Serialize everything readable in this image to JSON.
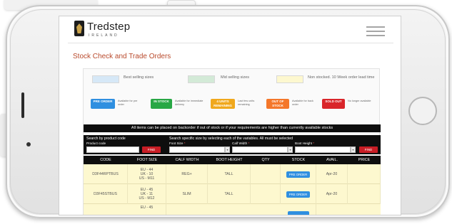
{
  "brand": {
    "name": "Tredstep",
    "sub": "IRELAND"
  },
  "page": {
    "title": "Stock Check and Trade Orders"
  },
  "legend": [
    {
      "label": "Best selling sizes",
      "color": "#d6e8f7"
    },
    {
      "label": "Mid selling sizes",
      "color": "#d3ead7"
    },
    {
      "label": "Non stocked. 10 Week order lead time",
      "color": "#fdf8cf"
    }
  ],
  "statuses": [
    {
      "badge": "PRE ORDER",
      "desc": "Available for pre order",
      "color": "#2f8fe0"
    },
    {
      "badge": "IN STOCK",
      "desc": "Available for immediate delivery",
      "color": "#28a745"
    },
    {
      "badge": "4 UNITS REMAINING",
      "desc": "Last few units remaining",
      "color": "#f0a81c"
    },
    {
      "badge": "OUT OF STOCK",
      "desc": "Available for back order",
      "color": "#f4772a"
    },
    {
      "badge": "SOLD OUT",
      "desc": "No longer available",
      "color": "#d9252a"
    }
  ],
  "backorder_notice": "All items can be placed on backorder if out of stock or if your requirements are higher than currently available stocks",
  "search": {
    "by_product_title": "Search by product code",
    "product_code_label": "Product code",
    "find_label": "FIND",
    "by_size_title": "Search specific size by selecting each of the variables. All must be selected",
    "foot_size_label": "Foot Size",
    "calf_width_label": "Calf Width",
    "boot_height_label": "Boot Height",
    "required_mark": "*",
    "caret": "▾"
  },
  "table": {
    "headers": [
      "CODE",
      "FOOT SIZE",
      "CALF WIDTH",
      "BOOT HEIGHT",
      "QTY",
      "STOCK",
      "AVAIL.",
      "PRICE"
    ],
    "rows": [
      {
        "code": "D3F44RPTBUS",
        "foot": [
          "EU - 44",
          "UK - 10",
          "US - M11"
        ],
        "calf": "REG+",
        "height": "TALL",
        "qty": "",
        "stock": "PRE ORDER",
        "avail": "Apr-20",
        "price": ""
      },
      {
        "code": "D3F45STBUS",
        "foot": [
          "EU - 45",
          "UK - 11",
          "US - M12"
        ],
        "calf": "SLIM",
        "height": "TALL",
        "qty": "",
        "stock": "PRE ORDER",
        "avail": "Apr-20",
        "price": ""
      },
      {
        "code": "",
        "foot": [
          "EU - 45"
        ],
        "calf": "",
        "height": "",
        "qty": "",
        "stock": "",
        "avail": "",
        "price": ""
      }
    ]
  }
}
